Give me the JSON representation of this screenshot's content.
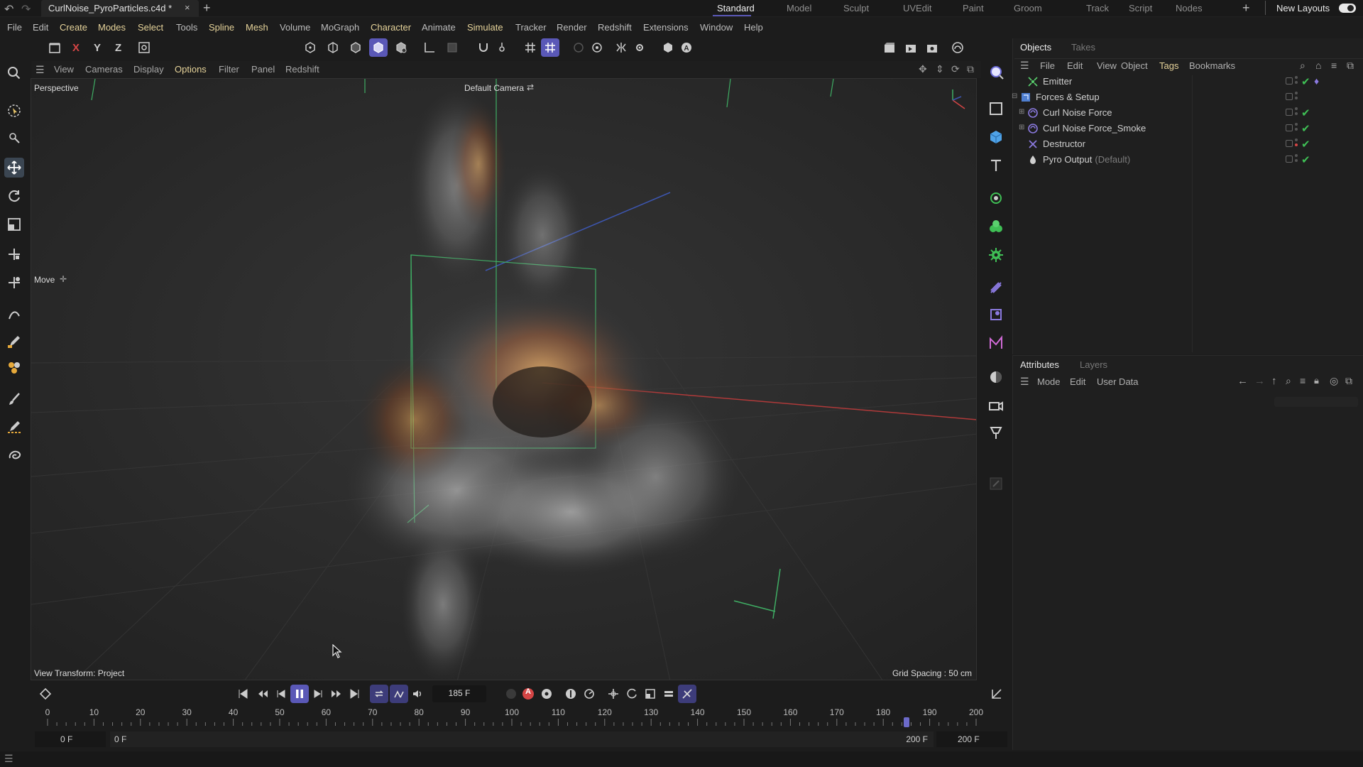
{
  "titlebar": {
    "doc_tab": "CurlNoise_PyroParticles.c4d *",
    "layouts": [
      "Standard",
      "Model",
      "Sculpt",
      "UVEdit",
      "Paint",
      "Groom",
      "Track",
      "Script",
      "Nodes"
    ],
    "active_layout": "Standard",
    "new_layouts": "New Layouts"
  },
  "menubar": [
    "File",
    "Edit",
    "Create",
    "Modes",
    "Select",
    "Tools",
    "Spline",
    "Mesh",
    "Volume",
    "MoGraph",
    "Character",
    "Animate",
    "Simulate",
    "Tracker",
    "Render",
    "Redshift",
    "Extensions",
    "Window",
    "Help"
  ],
  "toolbar": {
    "axes": [
      "X",
      "Y",
      "Z"
    ]
  },
  "viewmenu": [
    "View",
    "Cameras",
    "Display",
    "Options",
    "Filter",
    "Panel",
    "Redshift"
  ],
  "viewport": {
    "view_name": "Perspective",
    "camera": "Default Camera",
    "tool_label": "Move",
    "view_transform": "View Transform: Project",
    "grid_spacing": "Grid Spacing : 50 cm"
  },
  "objects_panel": {
    "tabs": [
      "Objects",
      "Takes"
    ],
    "menu": [
      "File",
      "Edit",
      "View",
      "Object",
      "Tags",
      "Bookmarks"
    ],
    "items": [
      {
        "name": "Emitter",
        "sub": ""
      },
      {
        "name": "Forces & Setup",
        "sub": ""
      },
      {
        "name": "Curl Noise Force",
        "sub": ""
      },
      {
        "name": "Curl Noise Force_Smoke",
        "sub": ""
      },
      {
        "name": "Destructor",
        "sub": ""
      },
      {
        "name": "Pyro Output",
        "sub": "(Default)"
      }
    ]
  },
  "attributes_panel": {
    "tabs": [
      "Attributes",
      "Layers"
    ],
    "menu": [
      "Mode",
      "Edit",
      "User Data"
    ]
  },
  "timeline": {
    "current_frame": "185 F",
    "current_frame_value": 185,
    "range_end": 200,
    "ticks": [
      "0",
      "10",
      "20",
      "30",
      "40",
      "50",
      "60",
      "70",
      "80",
      "90",
      "100",
      "110",
      "120",
      "130",
      "140",
      "150",
      "160",
      "170",
      "180",
      "190",
      "200"
    ],
    "start_field": "0 F",
    "preview_start": "0 F",
    "preview_end": "200 F",
    "end_field": "200 F",
    "record_label": "A"
  },
  "colors": {
    "accent": "#5a58b7",
    "check": "#3fbf55",
    "highlight_menu": "#e6d39a"
  }
}
